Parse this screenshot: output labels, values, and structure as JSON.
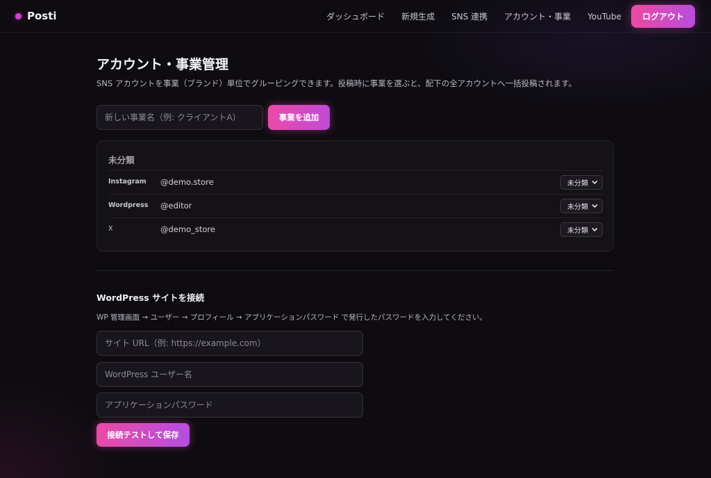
{
  "app": {
    "name": "Posti",
    "accent_color": "#d63fd3"
  },
  "nav": {
    "items": [
      "ダッシュボード",
      "新規生成",
      "SNS 連携",
      "アカウント・事業",
      "YouTube"
    ],
    "logout_label": "ログアウト"
  },
  "page": {
    "title": "アカウント・事業管理",
    "description": "SNS アカウントを事業（ブランド）単位でグルーピングできます。投稿時に事業を選ぶと、配下の全アカウントへ一括投稿されます。"
  },
  "business_form": {
    "placeholder": "新しい事業名（例: クライアントA）",
    "value": "",
    "add_button_label": "事業を追加"
  },
  "groups": [
    {
      "title": "未分類",
      "accounts": [
        {
          "platform": "Instagram",
          "handle": "@demo.store",
          "business": "未分類"
        },
        {
          "platform": "Wordpress",
          "handle": "@editor",
          "business": "未分類"
        },
        {
          "platform": "X",
          "handle": "@demo_store",
          "business": "未分類"
        }
      ]
    }
  ],
  "wordpress": {
    "title": "WordPress サイトを接続",
    "description": "WP 管理画面 → ユーザー → プロフィール → アプリケーションパスワード で発行したパスワードを入力してください。",
    "url_placeholder": "サイト URL（例: https://example.com）",
    "user_placeholder": "WordPress ユーザー名",
    "password_placeholder": "アプリケーションパスワード",
    "save_button_label": "接続テストして保存"
  }
}
